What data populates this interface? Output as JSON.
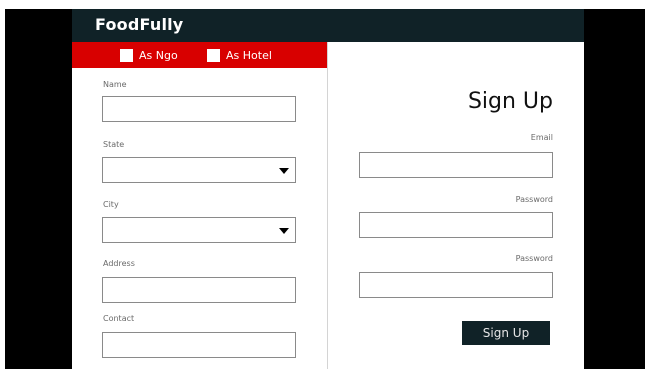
{
  "navbar": {
    "brand": "FoodFully"
  },
  "role_selector": {
    "options": [
      {
        "label": "As Ngo",
        "checked": false
      },
      {
        "label": "As Hotel",
        "checked": false
      }
    ]
  },
  "registration_form": {
    "name_label": "Name",
    "name_value": "",
    "state_label": "State",
    "state_selected": "",
    "city_label": "City",
    "city_selected": "",
    "address_label": "Address",
    "address_value": "",
    "contact_label": "Contact",
    "contact_value": ""
  },
  "signup_form": {
    "title": "Sign Up",
    "email_label": "Email",
    "email_value": "",
    "password_label": "Password",
    "password_value": "",
    "confirm_password_label": "Password",
    "confirm_password_value": "",
    "submit_label": "Sign Up"
  },
  "colors": {
    "navbar_bg": "#102227",
    "role_bar_bg": "#d80000",
    "button_bg": "#102227",
    "letterbox": "#000000"
  },
  "icons": {
    "select_caret": "caret-down-icon",
    "checkbox": "checkbox-icon"
  }
}
